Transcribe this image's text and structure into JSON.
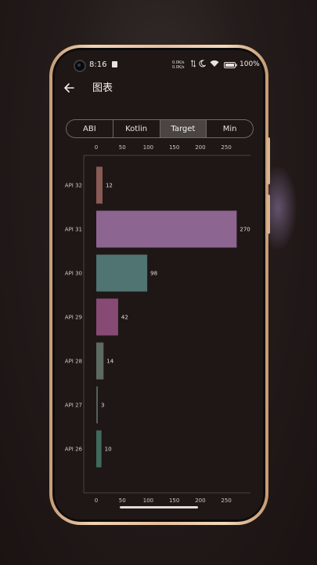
{
  "status_bar": {
    "time": "8:16",
    "net_speed_up": "0.0K/s",
    "net_speed_down": "0.0K/s",
    "battery": "100%"
  },
  "app_bar": {
    "title": "图表",
    "back_icon": "arrow-left-icon"
  },
  "tabs": [
    {
      "label": "ABI",
      "active": false
    },
    {
      "label": "Kotlin",
      "active": false
    },
    {
      "label": "Target",
      "active": true
    },
    {
      "label": "Min",
      "active": false
    }
  ],
  "chart_data": {
    "type": "bar",
    "orientation": "horizontal",
    "categories": [
      "API 32",
      "API 31",
      "API 30",
      "API 29",
      "API 28",
      "API 27",
      "API 26"
    ],
    "values": [
      12,
      270,
      98,
      42,
      14,
      3,
      10
    ],
    "colors": [
      "#8a5a55",
      "#8c6590",
      "#4f7471",
      "#874a75",
      "#5d6a62",
      "#55605c",
      "#416a5e"
    ],
    "xticks": [
      0,
      50,
      100,
      150,
      200,
      250
    ],
    "xlim": [
      0,
      295
    ],
    "ticks_top_and_bottom": true,
    "data_labels": true
  }
}
